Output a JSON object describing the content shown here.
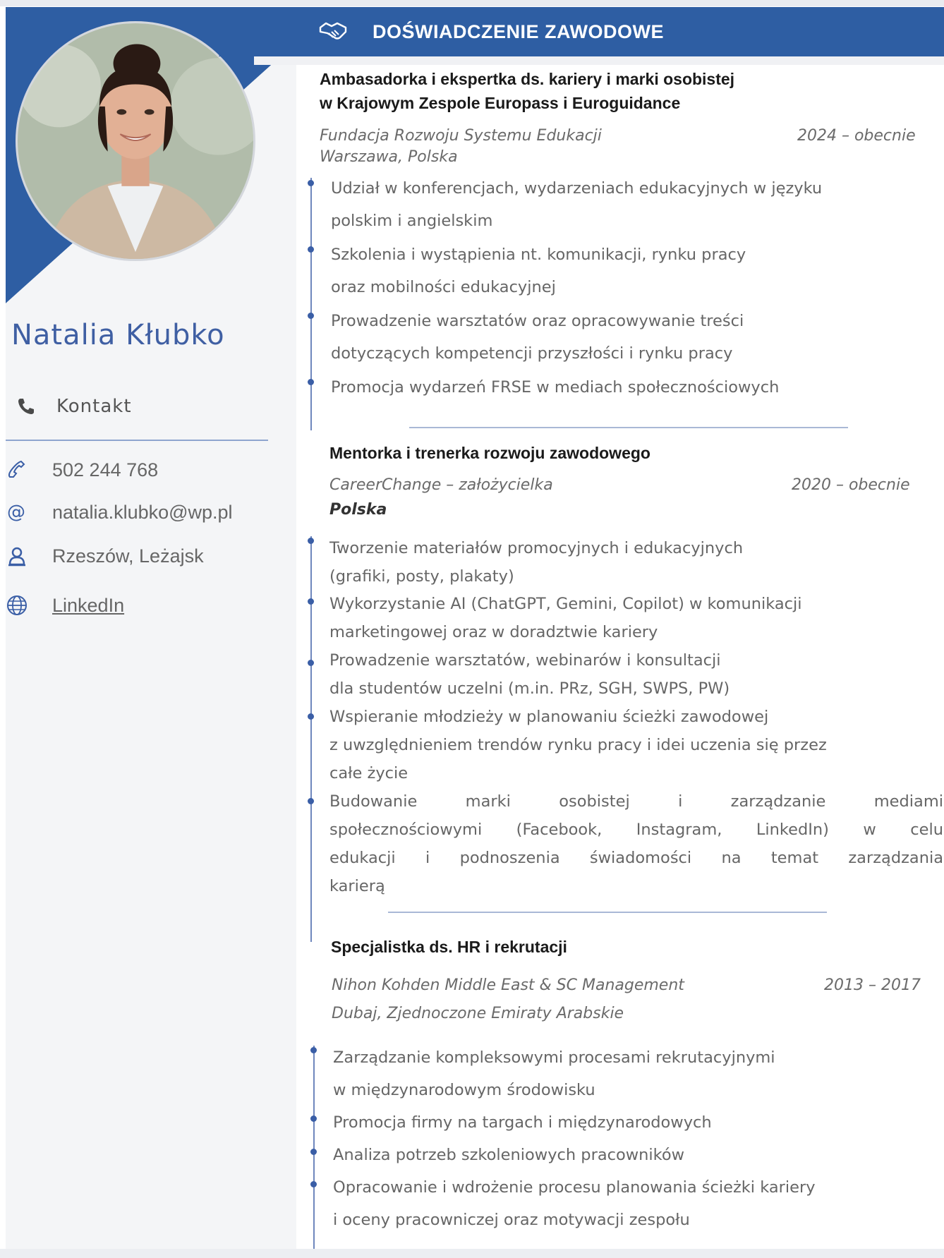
{
  "person": {
    "name": "Natalia Kłubko"
  },
  "contact": {
    "heading": "Kontakt",
    "phone": "502 244 768",
    "email": "natalia.klubko@wp.pl",
    "location": "Rzeszów, Leżajsk",
    "linkedin": "LinkedIn"
  },
  "section": {
    "title": "DOŚWIADCZENIE ZAWODOWE",
    "icon": "handshake-icon"
  },
  "colors": {
    "accent": "#2e5ea3",
    "name": "#3f5fa3",
    "bullet": "#3a5ea6"
  },
  "jobs": [
    {
      "title_lines": [
        "Ambasadorka i ekspertka ds. kariery i marki osobistej",
        "w Krajowym Zespole Europass i Euroguidance"
      ],
      "org": "Fundacja Rozwoju Systemu Edukacji",
      "date": "2024 – obecnie",
      "loc": "Warszawa, Polska",
      "items": [
        [
          "Udział w konferencjach, wydarzeniach edukacyjnych w języku",
          "polskim i angielskim"
        ],
        [
          "Szkolenia i wystąpienia nt. komunikacji, rynku pracy",
          "oraz mobilności edukacyjnej"
        ],
        [
          "Prowadzenie warsztatów oraz opracowywanie treści",
          "dotyczących kompetencji przyszłości i rynku pracy"
        ],
        [
          "Promocja wydarzeń FRSE w mediach społecznościowych"
        ]
      ]
    },
    {
      "title_lines": [
        "Mentorka i trenerka rozwoju zawodowego"
      ],
      "org": "CareerChange – założycielka",
      "date": "2020 – obecnie",
      "loc": "Polska",
      "items": [
        [
          "Tworzenie materiałów promocyjnych i edukacyjnych",
          "(grafiki, posty, plakaty)"
        ],
        [
          "Wykorzystanie AI (ChatGPT, Gemini, Copilot) w komunikacji",
          "marketingowej oraz w doradztwie kariery"
        ],
        [
          "Prowadzenie warsztatów, webinarów i konsultacji",
          "dla studentów uczelni (m.in. PRz, SGH, SWPS, PW)"
        ],
        [
          "Wspieranie młodzieży w planowaniu ścieżki zawodowej",
          "z uwzględnieniem trendów rynku pracy i idei uczenia się przez",
          "całe życie"
        ],
        [
          "Budowanie marki osobistej i zarządzanie mediami",
          "społecznościowymi (Facebook, Instagram, LinkedIn) w celu",
          "edukacji i podnoszenia świadomości na temat zarządzania",
          "karierą"
        ]
      ]
    },
    {
      "title_lines": [
        "Specjalistka ds. HR i rekrutacji"
      ],
      "org": "Nihon Kohden Middle East & SC Management",
      "date": "2013 – 2017",
      "loc": "Dubaj, Zjednoczone Emiraty Arabskie",
      "items": [
        [
          "Zarządzanie kompleksowymi procesami rekrutacyjnymi",
          "w międzynarodowym środowisku"
        ],
        [
          "Promocja firmy na targach i międzynarodowych"
        ],
        [
          "Analiza potrzeb szkoleniowych pracowników"
        ],
        [
          "Opracowanie i wdrożenie procesu planowania ścieżki kariery",
          "i oceny pracowniczej oraz motywacji zespołu"
        ]
      ]
    }
  ]
}
